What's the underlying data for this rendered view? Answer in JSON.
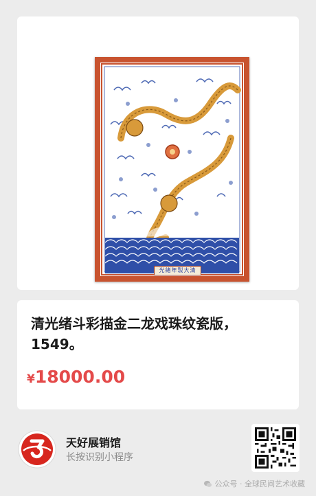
{
  "product": {
    "image_alt": "Dragon porcelain plaque",
    "plaque_label": "光緒年製大清",
    "title": "清光绪斗彩描金二龙戏珠纹瓷版，1549。",
    "price_symbol": "¥",
    "price_value": "18000.00"
  },
  "shop": {
    "name": "天好展销馆",
    "hint": "长按识别小程序",
    "logo_icon": "three-logo-icon",
    "qr_icon": "qr-code-icon"
  },
  "watermark": {
    "text": "公众号 · 全球民间艺术收藏"
  },
  "colors": {
    "background": "#ececec",
    "price": "#e44a4a",
    "frame": "#c8532f",
    "porcelain_blue": "#2f4fa8",
    "dragon_gold": "#d89a3a"
  }
}
